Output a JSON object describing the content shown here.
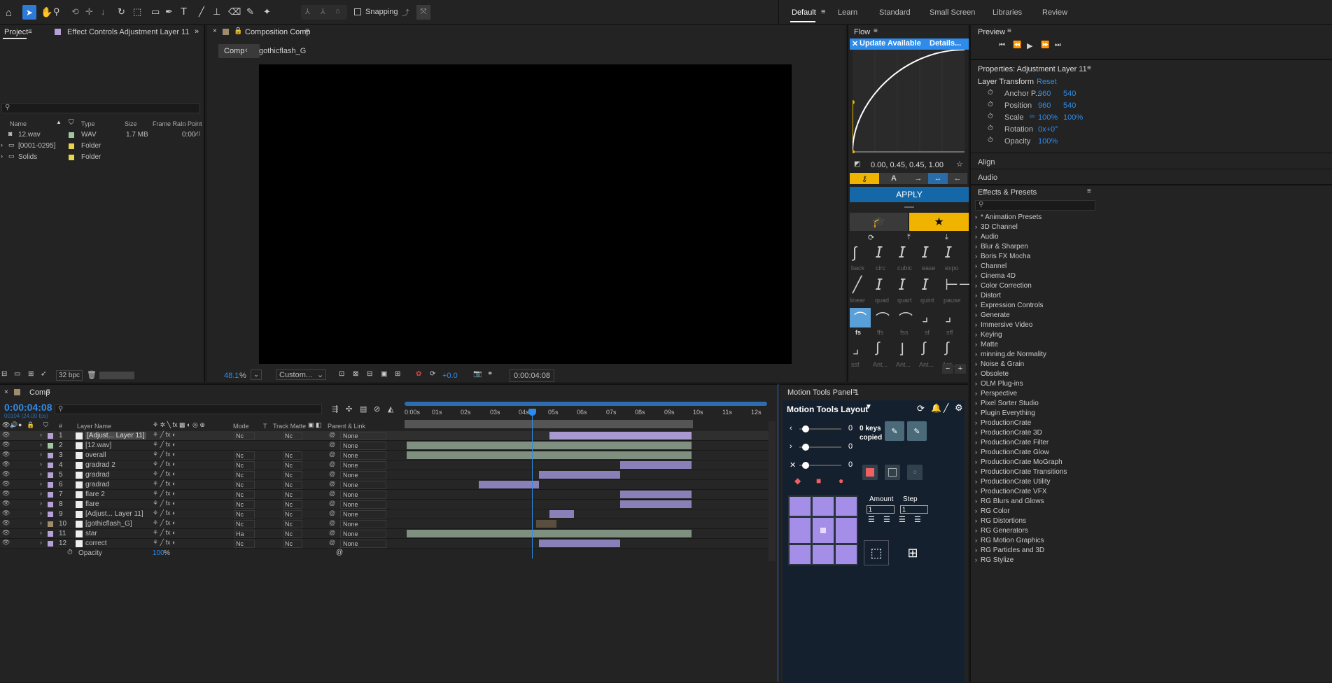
{
  "toolbar": {
    "snapping": "Snapping",
    "workspaces": [
      "Default",
      "Learn",
      "Standard",
      "Small Screen",
      "Libraries",
      "Review"
    ]
  },
  "project": {
    "tab": "Project",
    "effect_controls": "Effect Controls Adjustment Layer 11",
    "columns": [
      "Name",
      "Type",
      "Size",
      "Frame Ra...",
      "In Point"
    ],
    "items": [
      {
        "name": "12.wav",
        "type": "WAV",
        "size": "1.7 MB",
        "in": "0:00",
        "color": "#a0c8a0"
      },
      {
        "name": "[0001-0295]",
        "type": "Folder",
        "size": "",
        "in": "",
        "color": "#e8d44a"
      },
      {
        "name": "Solids",
        "type": "Folder",
        "size": "",
        "in": "",
        "color": "#e8d44a"
      }
    ],
    "bpc": "32 bpc"
  },
  "comp": {
    "title": "Composition Comp",
    "crumb": "Comp",
    "crumb2": "gothicflash_G",
    "zoom": "48.1",
    "zoom_unit": "%",
    "view": "Custom...",
    "exposure": "+0.0",
    "time": "0:00:04:08"
  },
  "flow": {
    "title": "Flow",
    "update": "Update Available",
    "details": "Details...",
    "values": "0.00, 0.45, 0.45, 1.00",
    "apply": "APPLY",
    "presets_row1": [
      "back",
      "circ",
      "cubic",
      "ease",
      "expo"
    ],
    "presets_row2": [
      "linear",
      "quad",
      "quart",
      "quint",
      "pause"
    ],
    "presets_row3": [
      "fs",
      "ffs",
      "fss",
      "sf",
      "sff"
    ],
    "presets_row4": [
      "ssf",
      "Ant...",
      "Ant...",
      "Ant...",
      "Ant..."
    ]
  },
  "preview": {
    "title": "Preview"
  },
  "properties": {
    "title": "Properties: Adjustment Layer 11",
    "section": "Layer Transform",
    "reset": "Reset",
    "rows": [
      {
        "label": "Anchor P...",
        "v1": "960",
        "v2": "540"
      },
      {
        "label": "Position",
        "v1": "960",
        "v2": "540"
      },
      {
        "label": "Scale",
        "v1": "100%",
        "v2": "100%"
      },
      {
        "label": "Rotation",
        "v1": "0x+0°",
        "v2": ""
      },
      {
        "label": "Opacity",
        "v1": "100%",
        "v2": ""
      }
    ],
    "align": "Align",
    "audio": "Audio"
  },
  "effects": {
    "title": "Effects & Presets",
    "items": [
      "* Animation Presets",
      "3D Channel",
      "Audio",
      "Blur & Sharpen",
      "Boris FX Mocha",
      "Channel",
      "Cinema 4D",
      "Color Correction",
      "Distort",
      "Expression Controls",
      "Generate",
      "Immersive Video",
      "Keying",
      "Matte",
      "minning.de Normality",
      "Noise & Grain",
      "Obsolete",
      "OLM Plug-ins",
      "Perspective",
      "Pixel Sorter Studio",
      "Plugin Everything",
      "ProductionCrate",
      "ProductionCrate 3D",
      "ProductionCrate Filter",
      "ProductionCrate Glow",
      "ProductionCrate MoGraph",
      "ProductionCrate Transitions",
      "ProductionCrate Utility",
      "ProductionCrate VFX",
      "RG Blurs and Glows",
      "RG Color",
      "RG Distortions",
      "RG Generators",
      "RG Motion Graphics",
      "RG Particles and 3D",
      "RG Stylize"
    ]
  },
  "timeline": {
    "tab": "Comp",
    "time": "0:00:04:08",
    "fps": "00104 (24.00 fps)",
    "headers": {
      "num": "#",
      "name": "Layer Name",
      "mode": "Mode",
      "t": "T",
      "matte": "Track Matte",
      "parent": "Parent & Link"
    },
    "ruler": [
      "0:00s",
      "01s",
      "02s",
      "03s",
      "04s",
      "05s",
      "06s",
      "07s",
      "08s",
      "09s",
      "10s",
      "11s",
      "12s"
    ],
    "layers": [
      {
        "n": "1",
        "name": "[Adjust... Layer 11]",
        "mode": "Nc",
        "matte": "Nc",
        "parent": "None",
        "color": "#b5a0d8"
      },
      {
        "n": "2",
        "name": "[12.wav]",
        "mode": "",
        "matte": "",
        "parent": "None",
        "color": "#a0c8a0"
      },
      {
        "n": "3",
        "name": "overall",
        "mode": "Nc",
        "matte": "Nc",
        "parent": "None",
        "color": "#b5a0d8"
      },
      {
        "n": "4",
        "name": "gradrad 2",
        "mode": "Nc",
        "matte": "Nc",
        "parent": "None",
        "color": "#b5a0d8"
      },
      {
        "n": "5",
        "name": "gradrad",
        "mode": "Nc",
        "matte": "Nc",
        "parent": "None",
        "color": "#b5a0d8"
      },
      {
        "n": "6",
        "name": "gradrad",
        "mode": "Nc",
        "matte": "Nc",
        "parent": "None",
        "color": "#b5a0d8"
      },
      {
        "n": "7",
        "name": "flare 2",
        "mode": "Nc",
        "matte": "Nc",
        "parent": "None",
        "color": "#b5a0d8"
      },
      {
        "n": "8",
        "name": "flare",
        "mode": "Nc",
        "matte": "Nc",
        "parent": "None",
        "color": "#b5a0d8"
      },
      {
        "n": "9",
        "name": "[Adjust... Layer 11]",
        "mode": "Nc",
        "matte": "Nc",
        "parent": "None",
        "color": "#b5a0d8"
      },
      {
        "n": "10",
        "name": "[gothicflash_G]",
        "mode": "Nc",
        "matte": "Nc",
        "parent": "None",
        "color": "#a08c6c"
      },
      {
        "n": "11",
        "name": "star",
        "mode": "Ha",
        "matte": "Nc",
        "parent": "None",
        "color": "#b5a0d8"
      },
      {
        "n": "12",
        "name": "correct",
        "mode": "Nc",
        "matte": "Nc",
        "parent": "None",
        "color": "#b5a0d8"
      }
    ],
    "opacity_label": "Opacity",
    "opacity_value": "100",
    "opacity_unit": "%"
  },
  "motion": {
    "title": "Motion Tools Panel 1",
    "layout": "Motion Tools Layout",
    "sliders": [
      "0",
      "0",
      "0"
    ],
    "keys": "0 keys copied",
    "amount": "Amount",
    "step": "Step",
    "amount_val": "1",
    "step_val": "1"
  }
}
